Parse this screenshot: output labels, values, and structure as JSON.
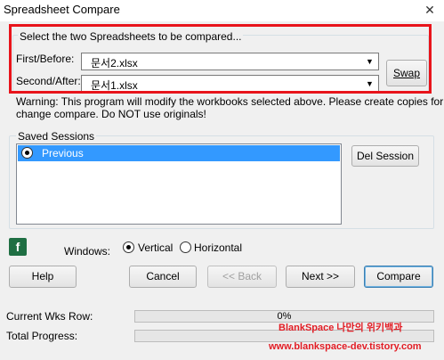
{
  "window": {
    "title": "Spreadsheet Compare",
    "close_glyph": "✕"
  },
  "selection": {
    "legend": "Select the two Spreadsheets to be compared...",
    "first_label": "First/Before:",
    "first_value": "문서2.xlsx",
    "second_label": "Second/After:",
    "second_value": "문서1.xlsx",
    "swap_label": "Swap",
    "highlight_color": "#e8141b"
  },
  "warning": {
    "line1": "Warning: This program will modify the workbooks selected above. Please create copies for this",
    "line2": "change compare. Do NOT use originals!"
  },
  "sessions": {
    "legend": "Saved Sessions",
    "items": [
      {
        "label": "Previous",
        "selected": true
      }
    ],
    "delete_label": "Del Session"
  },
  "options": {
    "excel_icon": "excel-icon",
    "windows_label": "Windows:",
    "vertical_label": "Vertical",
    "horizontal_label": "Horizontal",
    "selected": "Vertical"
  },
  "buttons": {
    "help": "Help",
    "cancel": "Cancel",
    "back": "<< Back",
    "next": "Next >>",
    "compare": "Compare"
  },
  "progress": {
    "wks_label": "Current Wks Row:",
    "wks_value": "0%",
    "total_label": "Total Progress:",
    "total_value": "0%"
  },
  "watermark": {
    "line1": "BlankSpace 나만의 위키백과",
    "line2": "www.blankspace-dev.tistory.com",
    "color": "#e21c24"
  }
}
